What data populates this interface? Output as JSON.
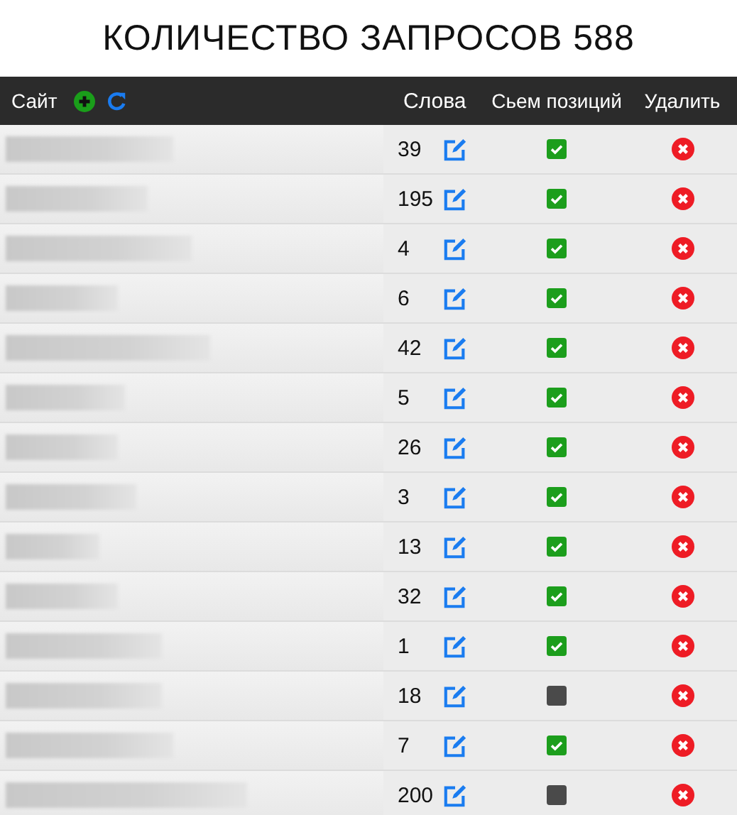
{
  "title": "КОЛИЧЕСТВО ЗАПРОСОВ 588",
  "table": {
    "columns": [
      "Сайт",
      "Слова",
      "Сьем позиций",
      "Удалить"
    ],
    "rows": [
      {
        "words": "39",
        "tracking": true
      },
      {
        "words": "195",
        "tracking": true
      },
      {
        "words": "4",
        "tracking": true
      },
      {
        "words": "6",
        "tracking": true
      },
      {
        "words": "42",
        "tracking": true
      },
      {
        "words": "5",
        "tracking": true
      },
      {
        "words": "26",
        "tracking": true
      },
      {
        "words": "3",
        "tracking": true
      },
      {
        "words": "13",
        "tracking": true
      },
      {
        "words": "32",
        "tracking": true
      },
      {
        "words": "1",
        "tracking": true
      },
      {
        "words": "18",
        "tracking": false
      },
      {
        "words": "7",
        "tracking": true
      },
      {
        "words": "200",
        "tracking": false
      }
    ]
  }
}
